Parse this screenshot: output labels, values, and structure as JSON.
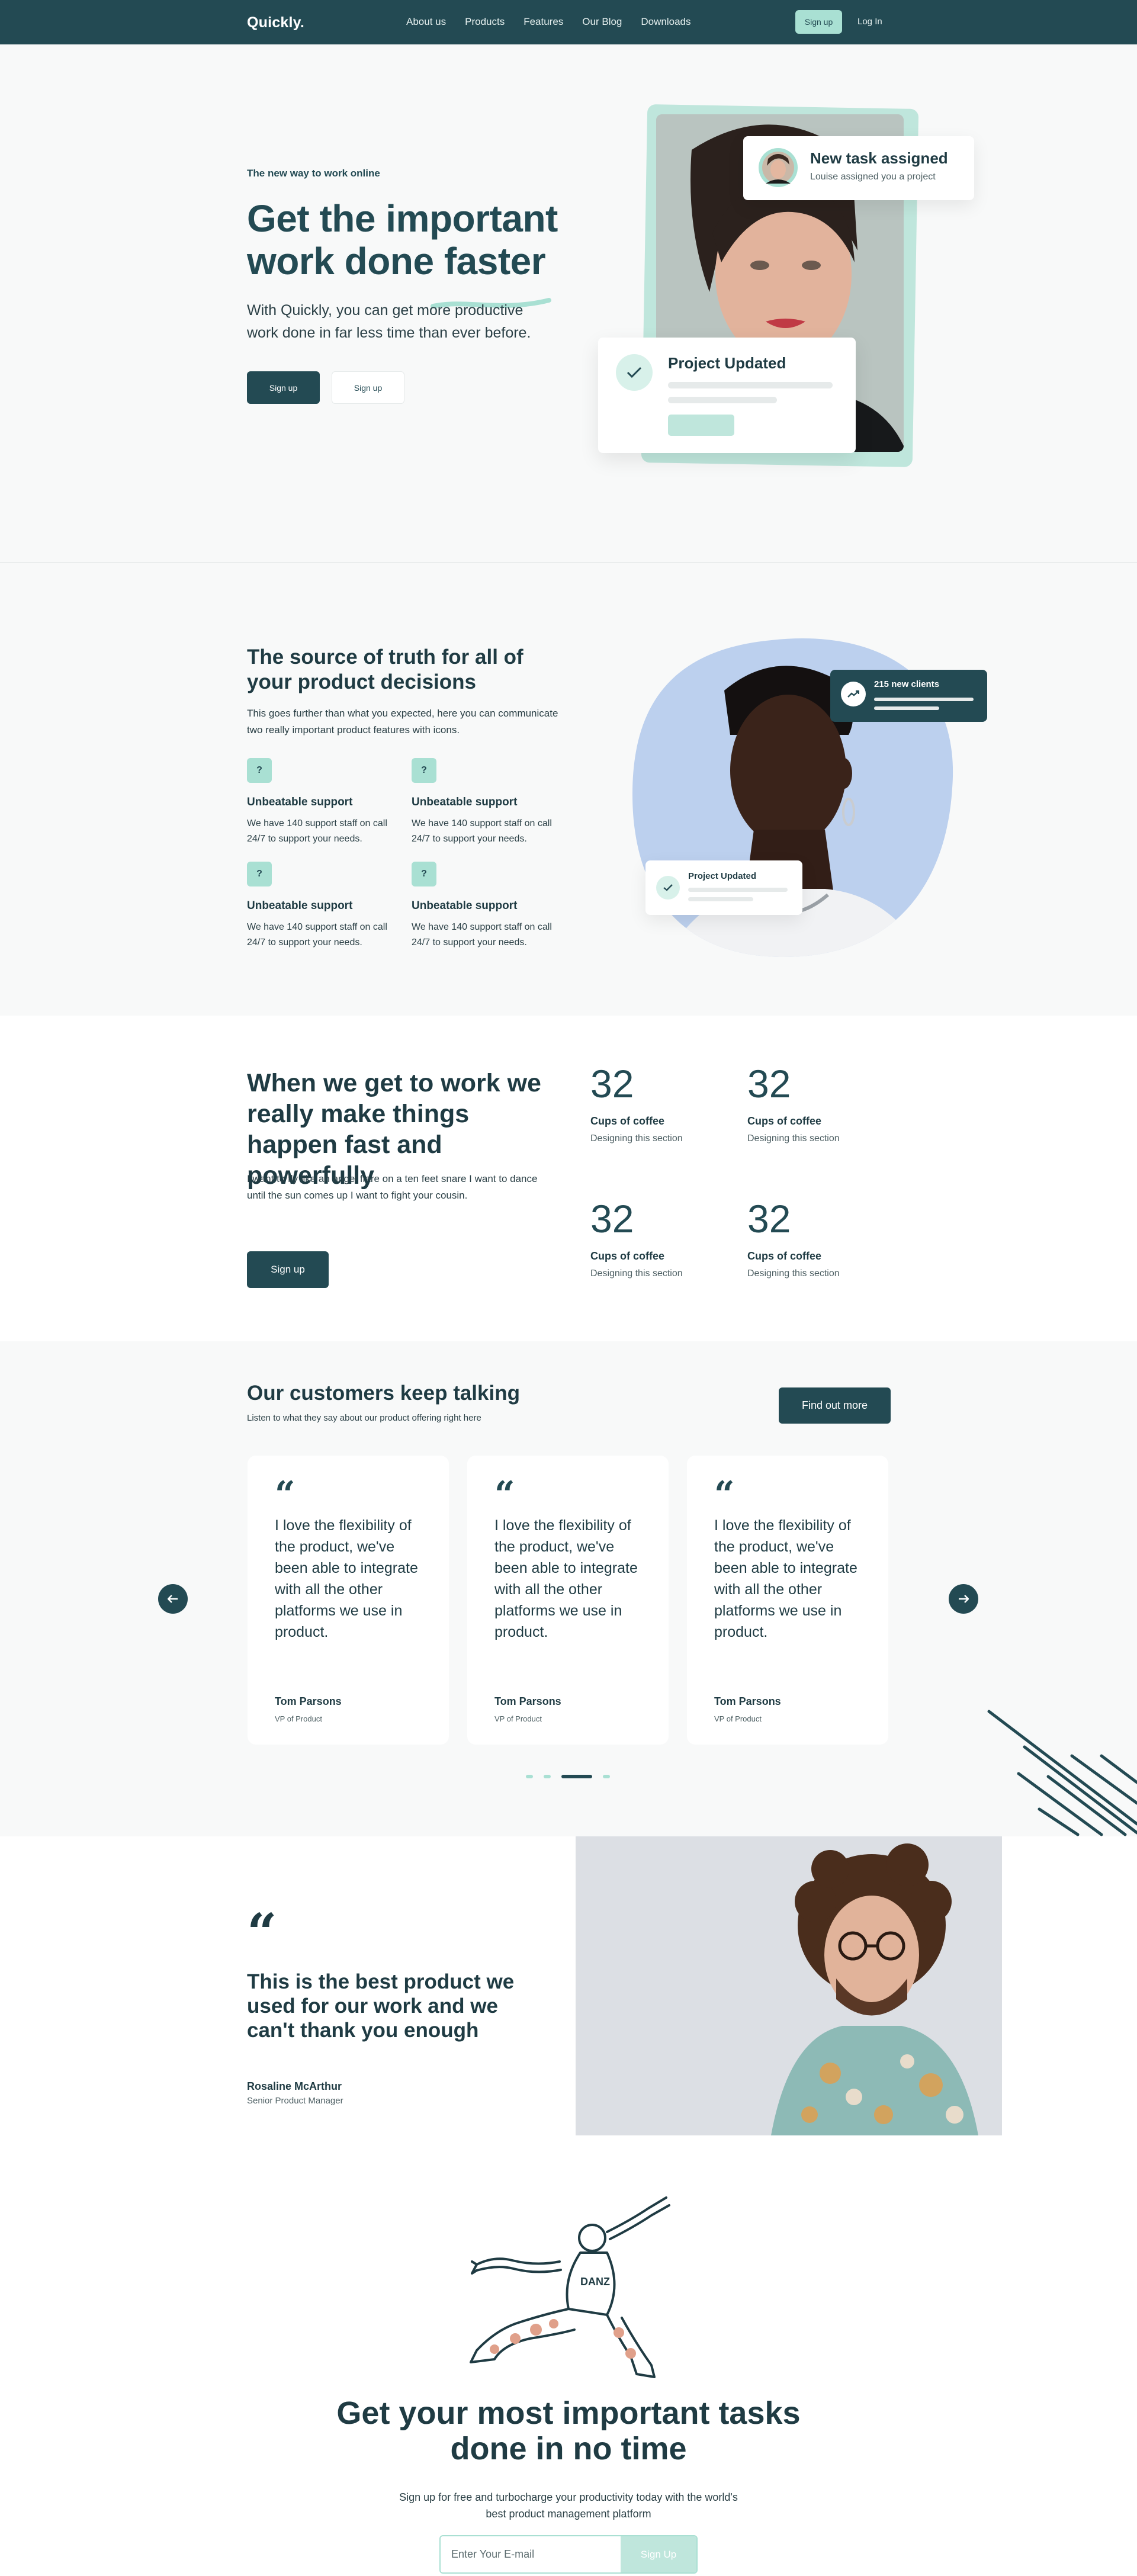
{
  "nav": {
    "logo": "Quickly.",
    "links": [
      "About us",
      "Products",
      "Features",
      "Our Blog",
      "Downloads"
    ],
    "signup": "Sign up",
    "login": "Log In"
  },
  "hero": {
    "eyebrow": "The new way to work online",
    "title": "Get the important work done faster",
    "subtitle": "With Quickly, you can get more productive work done in far less time than ever before.",
    "primary_button": "Sign up",
    "secondary_button": "Sign up",
    "task_card": {
      "title": "New task assigned",
      "text": "Louise assigned you a project"
    },
    "update_card": {
      "title": "Project Updated"
    }
  },
  "features": {
    "title": "The source of truth for all of your product decisions",
    "lead": "This goes further than what you expected, here you can communicate two really important product features with icons.",
    "items": [
      {
        "icon": "?",
        "title": "Unbeatable support",
        "text": "We have 140 support staff on call 24/7 to support your needs."
      },
      {
        "icon": "?",
        "title": "Unbeatable support",
        "text": "We have 140 support staff on call 24/7 to support your needs."
      },
      {
        "icon": "?",
        "title": "Unbeatable support",
        "text": "We have 140 support staff on call 24/7 to support your needs."
      },
      {
        "icon": "?",
        "title": "Unbeatable support",
        "text": "We have 140 support staff on call 24/7 to support your needs."
      }
    ],
    "clients_chip": "215 new clients",
    "update_chip": "Project Updated"
  },
  "stats": {
    "title": "When we get to work we really make things happen fast and powerfully",
    "lead": "I want to fly like an angel flare on a ten feet snare I want to dance until the sun comes up I want to fight your cousin.",
    "button": "Sign up",
    "items": [
      {
        "value": "32",
        "label": "Cups of coffee",
        "text": "Designing this section"
      },
      {
        "value": "32",
        "label": "Cups of coffee",
        "text": "Designing this section"
      },
      {
        "value": "32",
        "label": "Cups of coffee",
        "text": "Designing this section"
      },
      {
        "value": "32",
        "label": "Cups of coffee",
        "text": "Designing this section"
      }
    ]
  },
  "testimonials": {
    "title": "Our customers keep talking",
    "subtitle": "Listen to what they say about our product offering right here",
    "button": "Find out more",
    "cards": [
      {
        "quote": "I love the flexibility of the product, we've been able to integrate with all the other platforms we use in product.",
        "name": "Tom Parsons",
        "role": "VP of Product"
      },
      {
        "quote": "I love the flexibility of the product, we've been able to integrate with all the other platforms we use in product.",
        "name": "Tom Parsons",
        "role": "VP of Product"
      },
      {
        "quote": "I love the flexibility of the product, we've been able to integrate with all the other platforms we use in product.",
        "name": "Tom Parsons",
        "role": "VP of Product"
      }
    ],
    "prev_icon": "arrow-left-icon",
    "next_icon": "arrow-right-icon",
    "active_slide": 3
  },
  "quote": {
    "text": "This is the best product we used for our work and we can't thank you enough",
    "name": "Rosaline McArthur",
    "role": "Senior Product Manager"
  },
  "cta": {
    "title": "Get your most important tasks done in no time",
    "text": "Sign up for free and turbocharge your productivity today with the world's best product management platform",
    "email_placeholder": "Enter Your E-mail",
    "button": "Sign Up"
  },
  "colors": {
    "primary": "#234a53",
    "accent": "#a9e0d3",
    "background": "#f8f9f9"
  }
}
